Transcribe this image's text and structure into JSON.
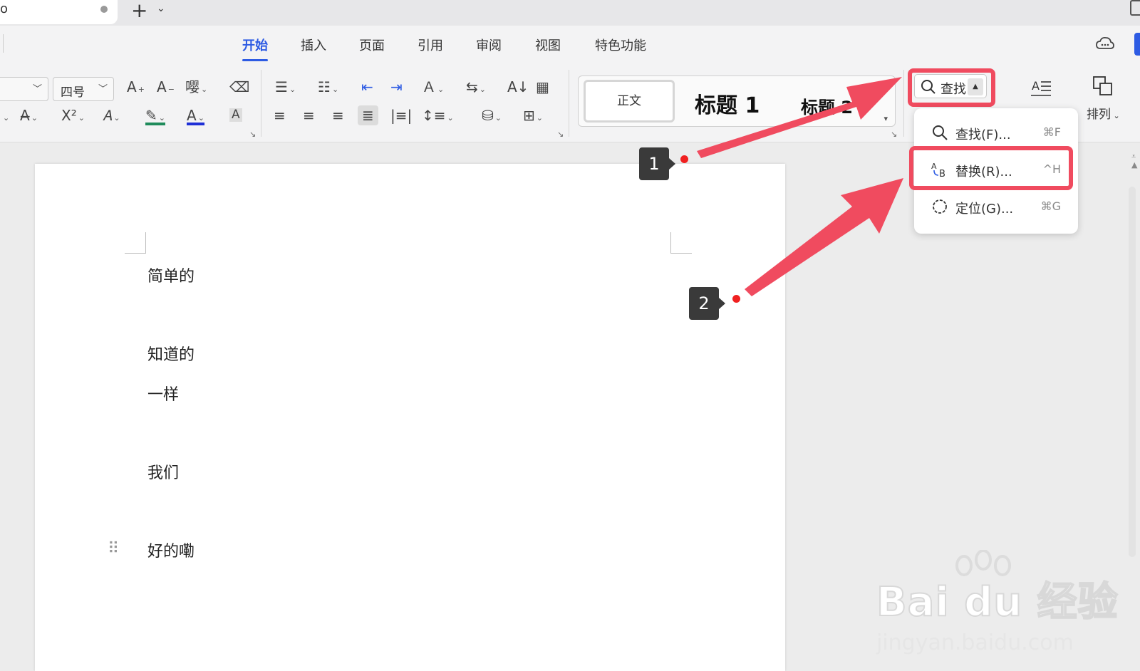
{
  "tabs": {
    "new_tab": "+",
    "new_tab_menu": "⌄",
    "partial_tab_edge": "o"
  },
  "menu": {
    "items": [
      "开始",
      "插入",
      "页面",
      "引用",
      "审阅",
      "视图",
      "特色功能"
    ],
    "active": "开始"
  },
  "toolbar": {
    "font_size": "四号",
    "find_button_label": "查找",
    "find_caret": "▲",
    "arrange_label": "排列"
  },
  "styles": {
    "normal": "正文",
    "heading1": "标题 1",
    "heading2": "标题 2"
  },
  "find_menu": {
    "items": [
      {
        "label": "查找(F)...",
        "shortcut": "⌘F"
      },
      {
        "label": "替换(R)...",
        "shortcut": "^H"
      },
      {
        "label": "定位(G)...",
        "shortcut": "⌘G"
      }
    ]
  },
  "document": {
    "paragraphs": [
      "简单的",
      "知道的",
      "一样",
      "我们",
      "好的嘞"
    ]
  },
  "callouts": [
    "1",
    "2"
  ],
  "watermark": {
    "main": "Bai du 经验",
    "sub": "jingyan.baidu.com"
  },
  "colors": {
    "accent": "#2d5be3",
    "highlight": "#f04b5f",
    "callout": "#3a3a3a"
  }
}
